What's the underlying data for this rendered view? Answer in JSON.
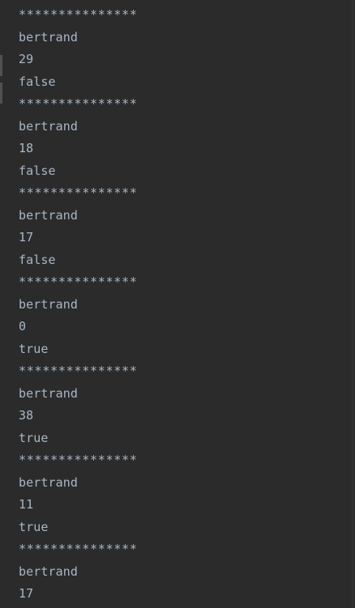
{
  "console": {
    "lines": [
      "***************",
      "bertrand",
      "29",
      "false",
      "***************",
      "bertrand",
      "18",
      "false",
      "***************",
      "bertrand",
      "17",
      "false",
      "***************",
      "bertrand",
      "0",
      "true",
      "***************",
      "bertrand",
      "38",
      "true",
      "***************",
      "bertrand",
      "11",
      "true",
      "***************",
      "bertrand",
      "17"
    ]
  },
  "colors": {
    "background": "#2b2b2b",
    "text": "#a9b7c6",
    "gutter_mark": "#4e5254"
  }
}
